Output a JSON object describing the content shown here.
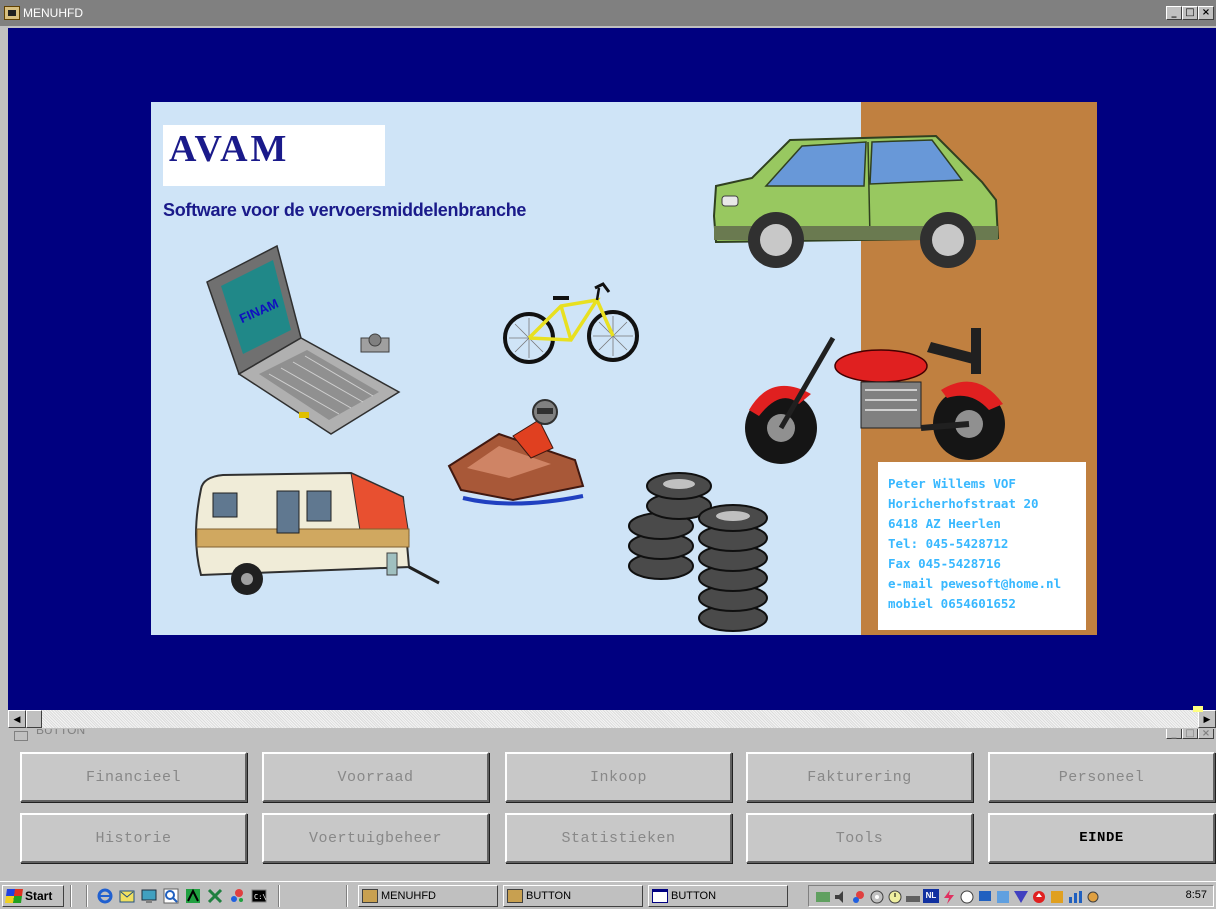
{
  "main_window": {
    "title": "MENUHFD",
    "controls": [
      "_",
      "□",
      "×"
    ]
  },
  "splash": {
    "logo": "AVAM",
    "tagline": "Software voor de vervoersmiddelenbranche",
    "laptop_screen_text": "FINAM",
    "contact_lines": [
      "Peter Willems VOF",
      "Horicherhofstraat 20",
      "6418 AZ  Heerlen",
      "Tel: 045-5428712",
      "Fax 045-5428716",
      "e-mail pewesoft@home.nl",
      "mobiel 0654601652"
    ],
    "colors": {
      "background": "#cfe4f7",
      "side_panel": "#c08040",
      "brand_text": "#1a1a8a",
      "contact_text": "#38b8ff",
      "window_background": "#000080"
    }
  },
  "button_window": {
    "title": "BUTTON",
    "controls": [
      "_",
      "□",
      "×"
    ],
    "buttons": [
      {
        "label": "Financieel"
      },
      {
        "label": "Voorraad"
      },
      {
        "label": "Inkoop"
      },
      {
        "label": "Fakturering"
      },
      {
        "label": "Personeel"
      },
      {
        "label": "Historie"
      },
      {
        "label": "Voertuigbeheer"
      },
      {
        "label": "Statistieken"
      },
      {
        "label": "Tools"
      },
      {
        "label": "EINDE"
      }
    ]
  },
  "taskbar": {
    "start_label": "Start",
    "tasks": [
      {
        "label": "MENUHFD",
        "icon": "avam-app-icon"
      },
      {
        "label": "BUTTON",
        "icon": "avam-app-icon"
      },
      {
        "label": "BUTTON",
        "icon": "window-icon"
      }
    ],
    "tray_language": "NL",
    "clock": "8:57"
  }
}
